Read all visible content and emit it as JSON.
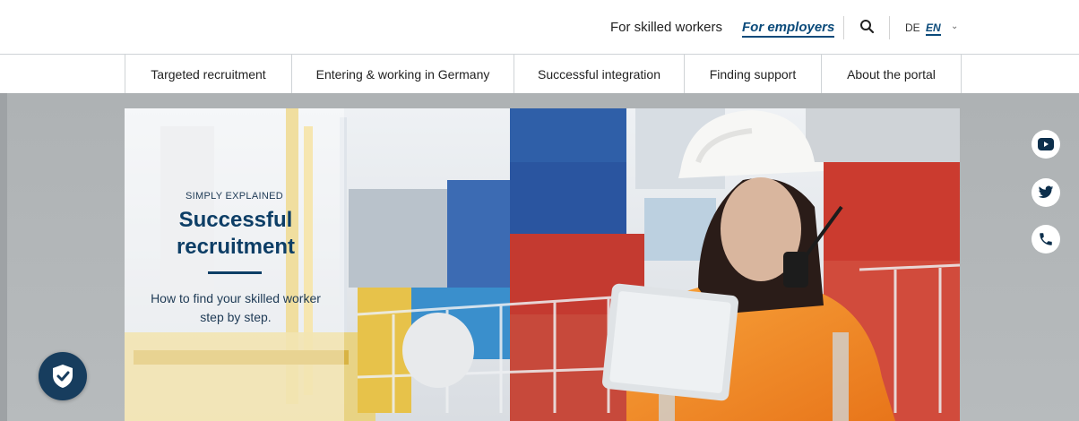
{
  "topbar": {
    "skilled_workers": "For skilled workers",
    "employers": "For employers",
    "search_icon": "search-icon",
    "lang_de": "DE",
    "lang_en": "EN"
  },
  "nav": {
    "items": [
      "Targeted recruitment",
      "Entering & working in Germany",
      "Successful integration",
      "Finding support",
      "About the portal"
    ]
  },
  "hero": {
    "eyebrow": "SIMPLY EXPLAINED",
    "title": "Successful recruitment",
    "text": "How to find your skilled worker step by step."
  },
  "social": [
    "youtube-icon",
    "twitter-icon",
    "phone-icon"
  ],
  "colors": {
    "brand_blue": "#0d3e66",
    "band_gray": "#b2b6b8",
    "vest_orange": "#f28a1e",
    "container_red": "#c8382e",
    "container_blue": "#2a5ea8"
  }
}
